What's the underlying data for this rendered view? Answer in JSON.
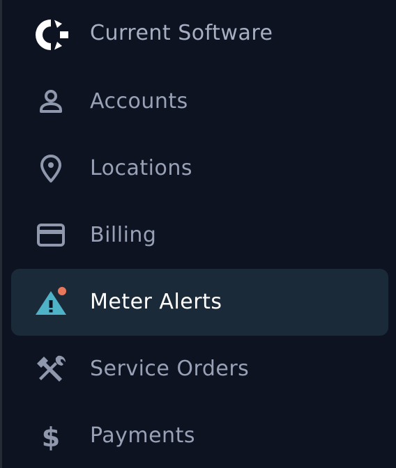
{
  "brand": {
    "name": "Current Software",
    "logo_icon": "current-software-logo",
    "logo_color": "#ffffff"
  },
  "nav": {
    "items": [
      {
        "label": "Accounts",
        "icon": "person-icon",
        "active": false
      },
      {
        "label": "Locations",
        "icon": "location-pin-icon",
        "active": false
      },
      {
        "label": "Billing",
        "icon": "credit-card-icon",
        "active": false
      },
      {
        "label": "Meter Alerts",
        "icon": "warning-triangle-icon",
        "active": true,
        "has_notification": true
      },
      {
        "label": "Service Orders",
        "icon": "tools-icon",
        "active": false
      },
      {
        "label": "Payments",
        "icon": "dollar-icon",
        "active": false
      }
    ]
  },
  "colors": {
    "background": "#0d1320",
    "active_background": "#1b2a38",
    "label_text": "#98a1b6",
    "active_label_text": "#ffffff",
    "icon_gray": "#8f98ac",
    "alert_icon": "#4fb3c8",
    "notification_dot": "#e8775c"
  }
}
